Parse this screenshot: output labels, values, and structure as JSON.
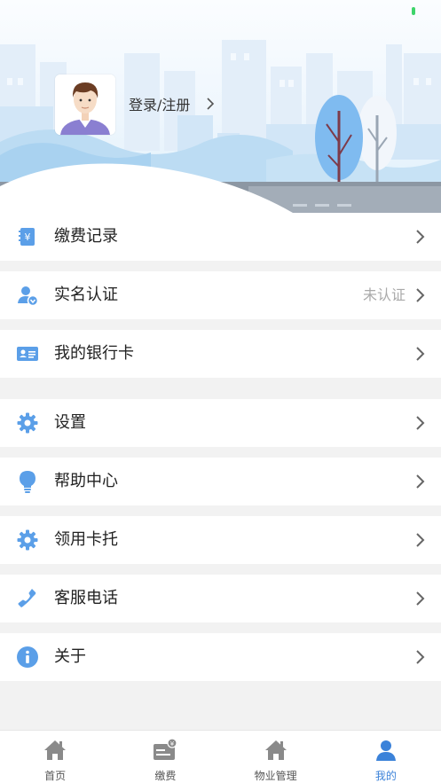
{
  "header": {
    "login_label": "登录/注册"
  },
  "menu": [
    {
      "label": "缴费记录",
      "icon": "bill-icon",
      "status": ""
    },
    {
      "label": "实名认证",
      "icon": "verify-user-icon",
      "status": "未认证"
    },
    {
      "label": "我的银行卡",
      "icon": "bank-card-icon",
      "status": ""
    },
    {
      "label": "设置",
      "icon": "gear-icon",
      "status": ""
    },
    {
      "label": "帮助中心",
      "icon": "lightbulb-icon",
      "status": ""
    },
    {
      "label": "领用卡托",
      "icon": "card-tray-icon",
      "status": ""
    },
    {
      "label": "客服电话",
      "icon": "phone-icon",
      "status": ""
    },
    {
      "label": "关于",
      "icon": "info-icon",
      "status": ""
    }
  ],
  "tabs": [
    {
      "label": "首页",
      "icon": "home-icon",
      "active": false
    },
    {
      "label": "缴费",
      "icon": "payment-icon",
      "active": false
    },
    {
      "label": "物业管理",
      "icon": "property-icon",
      "active": false
    },
    {
      "label": "我的",
      "icon": "profile-icon",
      "active": true
    }
  ],
  "colors": {
    "accent": "#3b82d9",
    "icon_blue": "#5b9fe8",
    "chevron": "#666666",
    "background": "#f2f2f2"
  }
}
